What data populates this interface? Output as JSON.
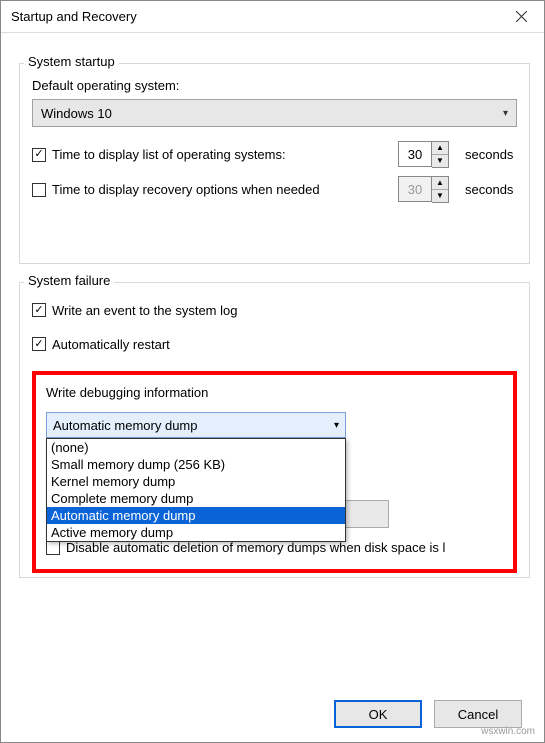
{
  "titlebar": {
    "title": "Startup and Recovery"
  },
  "startup": {
    "group_label": "System startup",
    "default_os_label": "Default operating system:",
    "default_os_value": "Windows 10",
    "display_list": {
      "label": "Time to display list of operating systems:",
      "value": "30",
      "unit": "seconds"
    },
    "display_recovery": {
      "label": "Time to display recovery options when needed",
      "value": "30",
      "unit": "seconds"
    }
  },
  "failure": {
    "group_label": "System failure",
    "write_event": "Write an event to the system log",
    "auto_restart": "Automatically restart"
  },
  "debug": {
    "group_label": "Write debugging information",
    "selected": "Automatic memory dump",
    "options": [
      "(none)",
      "Small memory dump (256 KB)",
      "Kernel memory dump",
      "Complete memory dump",
      "Automatic memory dump",
      "Active memory dump"
    ],
    "disable_deletion": "Disable automatic deletion of memory dumps when disk space is l"
  },
  "buttons": {
    "ok": "OK",
    "cancel": "Cancel"
  },
  "watermark": "wsxwin.com"
}
